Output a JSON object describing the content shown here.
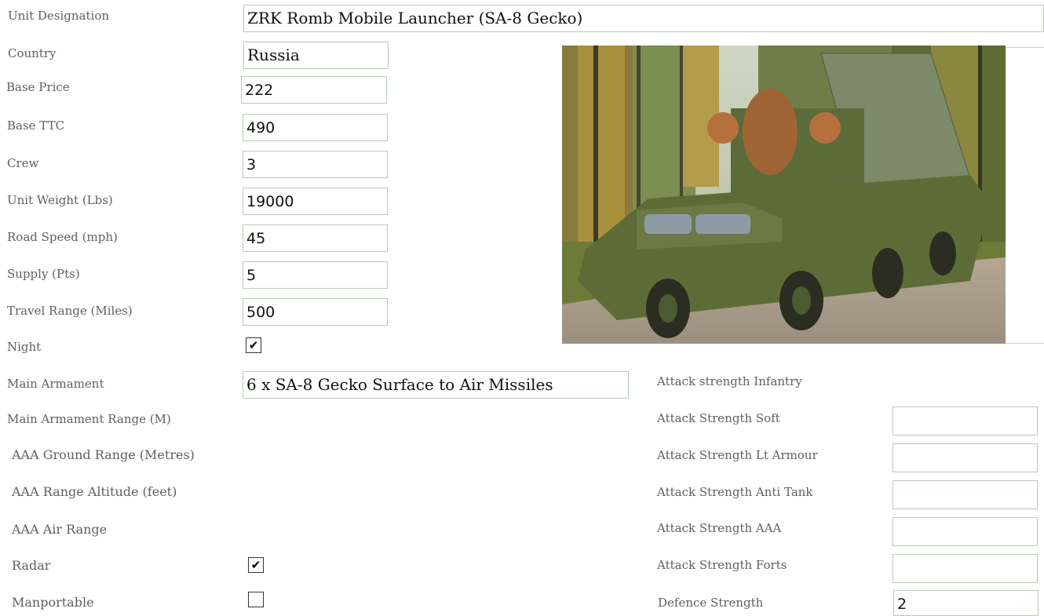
{
  "form": {
    "unit_designation": {
      "label": "Unit Designation",
      "value": "ZRK Romb Mobile Launcher (SA-8 Gecko)"
    },
    "country": {
      "label": "Country",
      "value": "Russia"
    },
    "base_price": {
      "label": "Base Price",
      "value": "222"
    },
    "base_ttc": {
      "label": "Base TTC",
      "value": "490"
    },
    "crew": {
      "label": "Crew",
      "value": "3"
    },
    "unit_weight": {
      "label": "Unit Weight (Lbs)",
      "value": "19000"
    },
    "road_speed": {
      "label": "Road Speed (mph)",
      "value": "45"
    },
    "supply": {
      "label": "Supply (Pts)",
      "value": "5"
    },
    "travel_range": {
      "label": "Travel Range (Miles)",
      "value": "500"
    },
    "night": {
      "label": "Night",
      "checked": true
    },
    "main_armament": {
      "label": "Main Armament",
      "value": "6 x SA-8 Gecko Surface to Air Missiles"
    },
    "main_armament_range": {
      "label": "Main Armament Range (M)"
    },
    "aaa_ground_range": {
      "label": "AAA Ground Range (Metres)"
    },
    "aaa_range_altitude": {
      "label": "AAA Range Altitude (feet)"
    },
    "aaa_air_range": {
      "label": "AAA Air Range"
    },
    "radar": {
      "label": "Radar",
      "checked": true
    },
    "manportable": {
      "label": "Manportable",
      "checked": false
    }
  },
  "attack": {
    "infantry": {
      "label": "Attack strength Infantry"
    },
    "soft": {
      "label": "Attack Strength Soft",
      "value": ""
    },
    "lt_armour": {
      "label": "Attack Strength Lt Armour",
      "value": ""
    },
    "anti_tank": {
      "label": "Attack Strength Anti Tank",
      "value": ""
    },
    "aaa": {
      "label": "Attack Strength AAA",
      "value": ""
    },
    "forts": {
      "label": "Attack Strength Forts",
      "value": ""
    },
    "defence": {
      "label": "Defence Strength",
      "value": "2"
    }
  },
  "check_glyph": "✔",
  "photo": {
    "subject": "8x8 amphibious SAM launcher vehicle in forest clearing",
    "icon": "vehicle-photo"
  }
}
